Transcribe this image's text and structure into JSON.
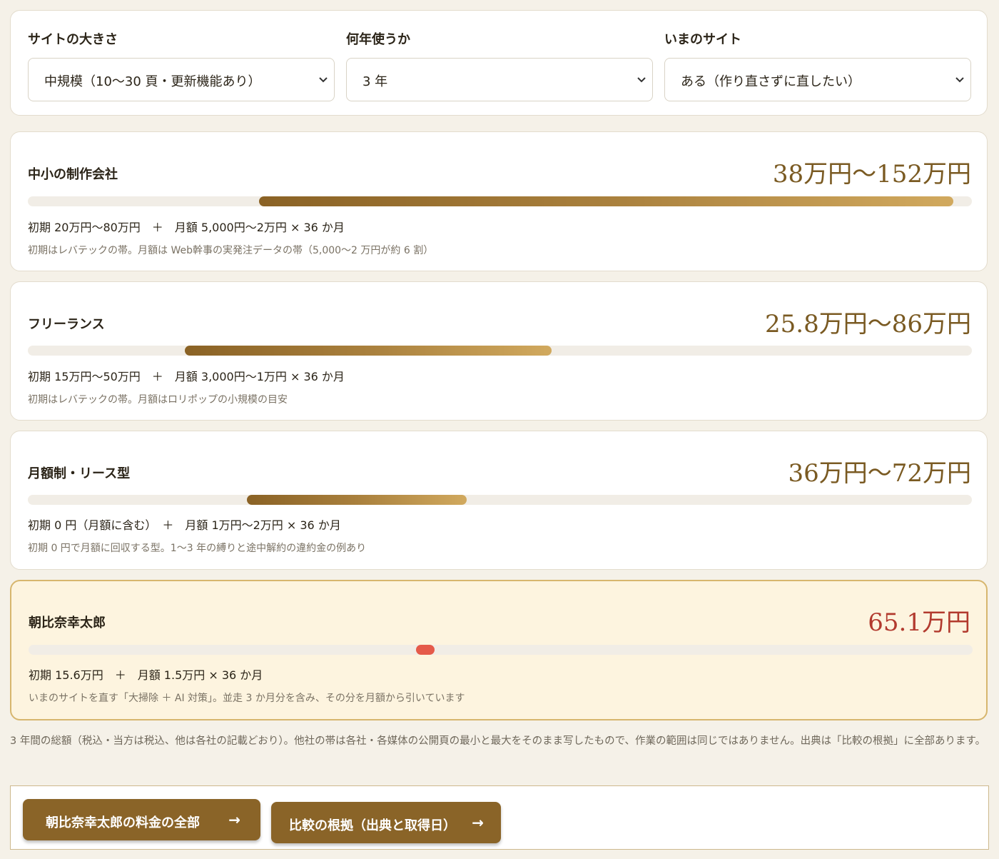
{
  "selectors": [
    {
      "label": "サイトの大きさ",
      "value": "中規模（10〜30 頁・更新機能あり）"
    },
    {
      "label": "何年使うか",
      "value": "3 年"
    },
    {
      "label": "いまのサイト",
      "value": "ある（作り直さずに直したい）"
    }
  ],
  "scale_max_yen": 1550000,
  "comparisons": [
    {
      "name": "中小の制作会社",
      "price": "38万円〜152万円",
      "range_yen": [
        380000,
        1520000
      ],
      "breakdown": "初期 20万円〜80万円　＋　月額 5,000円〜2万円 × 36 か月",
      "note": "初期はレバテックの帯。月額は Web幹事の実発注データの帯（5,000〜2 万円が約 6 割）"
    },
    {
      "name": "フリーランス",
      "price": "25.8万円〜86万円",
      "range_yen": [
        258000,
        860000
      ],
      "breakdown": "初期 15万円〜50万円　＋　月額 3,000円〜1万円 × 36 か月",
      "note": "初期はレバテックの帯。月額はロリポップの小規模の目安"
    },
    {
      "name": "月額制・リース型",
      "price": "36万円〜72万円",
      "range_yen": [
        360000,
        720000
      ],
      "breakdown": "初期 0 円（月額に含む）　＋　月額 1万円〜2万円 × 36 か月",
      "note": "初期 0 円で月額に回収する型。1〜3 年の縛りと途中解約の違約金の例あり"
    },
    {
      "name": "朝比奈幸太郎",
      "price": "65.1万円",
      "range_yen": [
        651000,
        651000
      ],
      "breakdown": "初期 15.6万円　＋　月額 1.5万円 × 36 か月",
      "note": "いまのサイトを直す「大掃除 ＋ AI 対策」。並走 3 か月分を含み、その分を月額から引いています",
      "highlight": true
    }
  ],
  "footnote": "3 年間の総額（税込・当方は税込、他は各社の記載どおり）。他社の帯は各社・各媒体の公開頁の最小と最大をそのまま写したもので、作業の範囲は同じではありません。出典は「比較の根拠」に全部あります。",
  "buttons": {
    "pricing": "朝比奈幸太郎の料金の全部",
    "sources": "比較の根拠（出典と取得日）",
    "arrow": "→"
  },
  "colors": {
    "accent": "#8a6428",
    "price_text": "#7a5a22",
    "highlight_price": "#b23a2e",
    "marker": "#e55a4a",
    "highlight_bg": "#fdf4df"
  },
  "icons": {
    "dropdown": "chevron-down-icon",
    "button_arrow": "arrow-right-icon"
  }
}
